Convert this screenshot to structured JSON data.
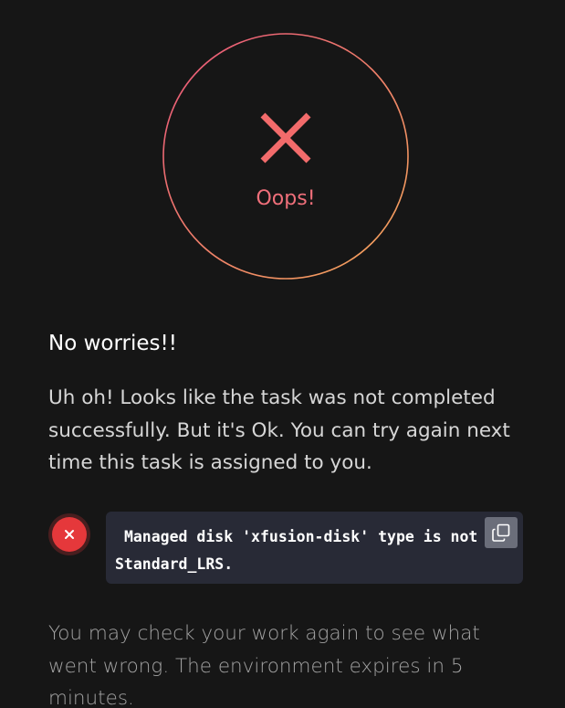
{
  "status": {
    "label": "Oops!",
    "icon": "x-mark-icon",
    "ring_gradient": [
      "#e8547a",
      "#f5a85a"
    ],
    "accent_color": "#f26b6b"
  },
  "heading": "No worries!!",
  "message": "Uh oh! Looks like the task was not completed successfully. But it's Ok. You can try again next time this task is assigned to you.",
  "result": {
    "icon": "error-icon",
    "badge_color": "#e5383b",
    "text": " Managed disk 'xfusion-disk' type is not Standard_LRS.",
    "copy_icon": "copy-icon"
  },
  "footer_note": "You may check your work again to see what went wrong. The environment expires in 5 minutes."
}
